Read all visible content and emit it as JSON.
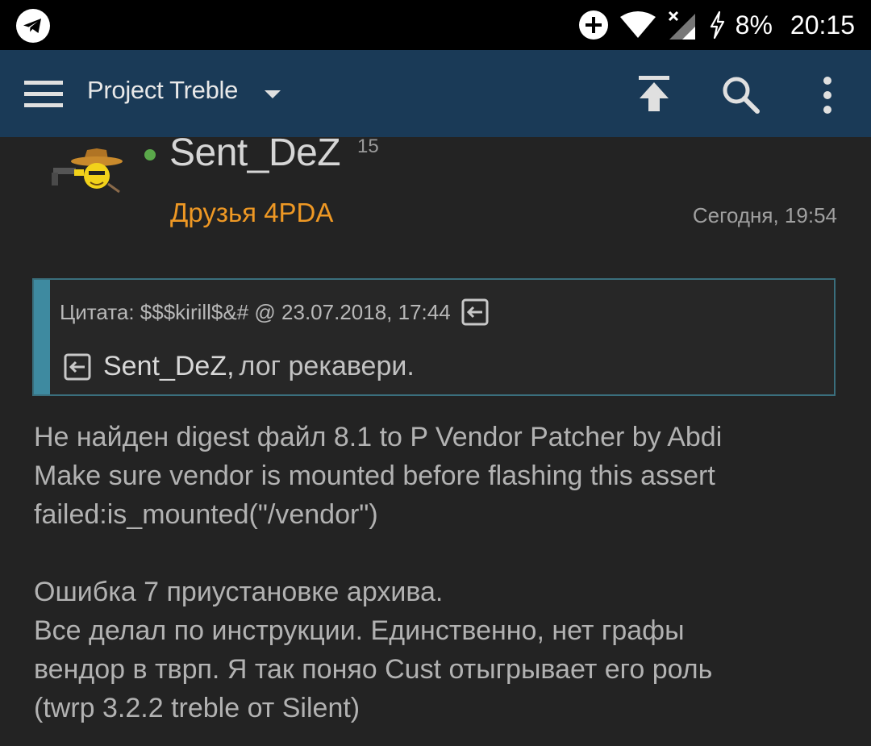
{
  "status_bar": {
    "notification_icon": "telegram-icon",
    "battery_percent": "8%",
    "time": "20:15",
    "icons": [
      "data-saver-icon",
      "wifi-icon",
      "no-signal-icon",
      "charging-icon"
    ]
  },
  "toolbar": {
    "title": "Project Treble",
    "icons": [
      "menu-icon",
      "dropdown-icon",
      "upload-icon",
      "search-icon",
      "more-icon"
    ]
  },
  "post": {
    "author": "Sent_DeZ",
    "reputation": "15",
    "group": "Друзья 4PDA",
    "date": "Сегодня, 19:54",
    "quote": {
      "header": "Цитата: $$$kirill$&# @ 23.07.2018, 17:44",
      "nick": "Sent_DeZ,",
      "text": "лог рекавери."
    },
    "body": {
      "line1": "Не найден digest файл 8.1 to P Vendor Patcher by Abdi",
      "line2": "Make sure vendor is mounted before flashing this assert",
      "line3": "failed:is_mounted(\"/vendor\")",
      "line4": "Ошибка 7 приустановке архива.",
      "line5": "Все делал по инструкции. Единственно, нет графы",
      "line6": "вендор в тврп. Я так поняо Cust отыгрывает его роль",
      "line7": "(twrp 3.2.2 treble от Silent)"
    }
  },
  "colors": {
    "toolbar_bg": "#1a3a57",
    "background": "#232323",
    "group_orange": "#ee9824",
    "online_green": "#5aa84a",
    "quote_accent": "#3e8aa0"
  }
}
